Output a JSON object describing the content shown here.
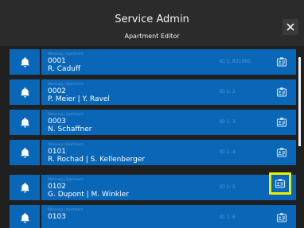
{
  "header": {
    "title": "Service Admin",
    "subtitle": "Apartment Editor",
    "close_icon": "close-icon"
  },
  "colors": {
    "background": "#202020",
    "header": "#2b2b2b",
    "row": "#0a67b8",
    "highlight": "#e9f000"
  },
  "rows": [
    {
      "category": "Wohnung | Apartment",
      "code": "0001",
      "names": "R. Caduff",
      "id": "ID 1: 831995",
      "icon": "bell-icon",
      "action_icon": "id-card-icon"
    },
    {
      "category": "Wohnung | Apartment",
      "code": "0002",
      "names": "P. Meier | Y. Ravel",
      "id": "ID 1: 2",
      "icon": "bell-icon",
      "action_icon": "id-card-icon"
    },
    {
      "category": "Wohnung | Apartment",
      "code": "0003",
      "names": "N. Schaffner",
      "id": "ID 1: 3",
      "icon": "bell-icon",
      "action_icon": "id-card-icon"
    },
    {
      "category": "Wohnung | Apartment",
      "code": "0101",
      "names": "R. Rochad | S. Kellenberger",
      "id": "ID 1: 4",
      "icon": "bell-icon",
      "action_icon": "id-card-icon"
    },
    {
      "category": "Wohnung | Apartment",
      "code": "0102",
      "names": "G. Dupont | M. Winkler",
      "id": "ID 1: 5",
      "icon": "bell-icon",
      "action_icon": "id-card-icon",
      "highlighted": true
    },
    {
      "category": "Wohnung | Apartment",
      "code": "0103",
      "names": "",
      "id": "ID 1: 6",
      "icon": "bell-icon",
      "action_icon": "id-card-icon"
    }
  ]
}
